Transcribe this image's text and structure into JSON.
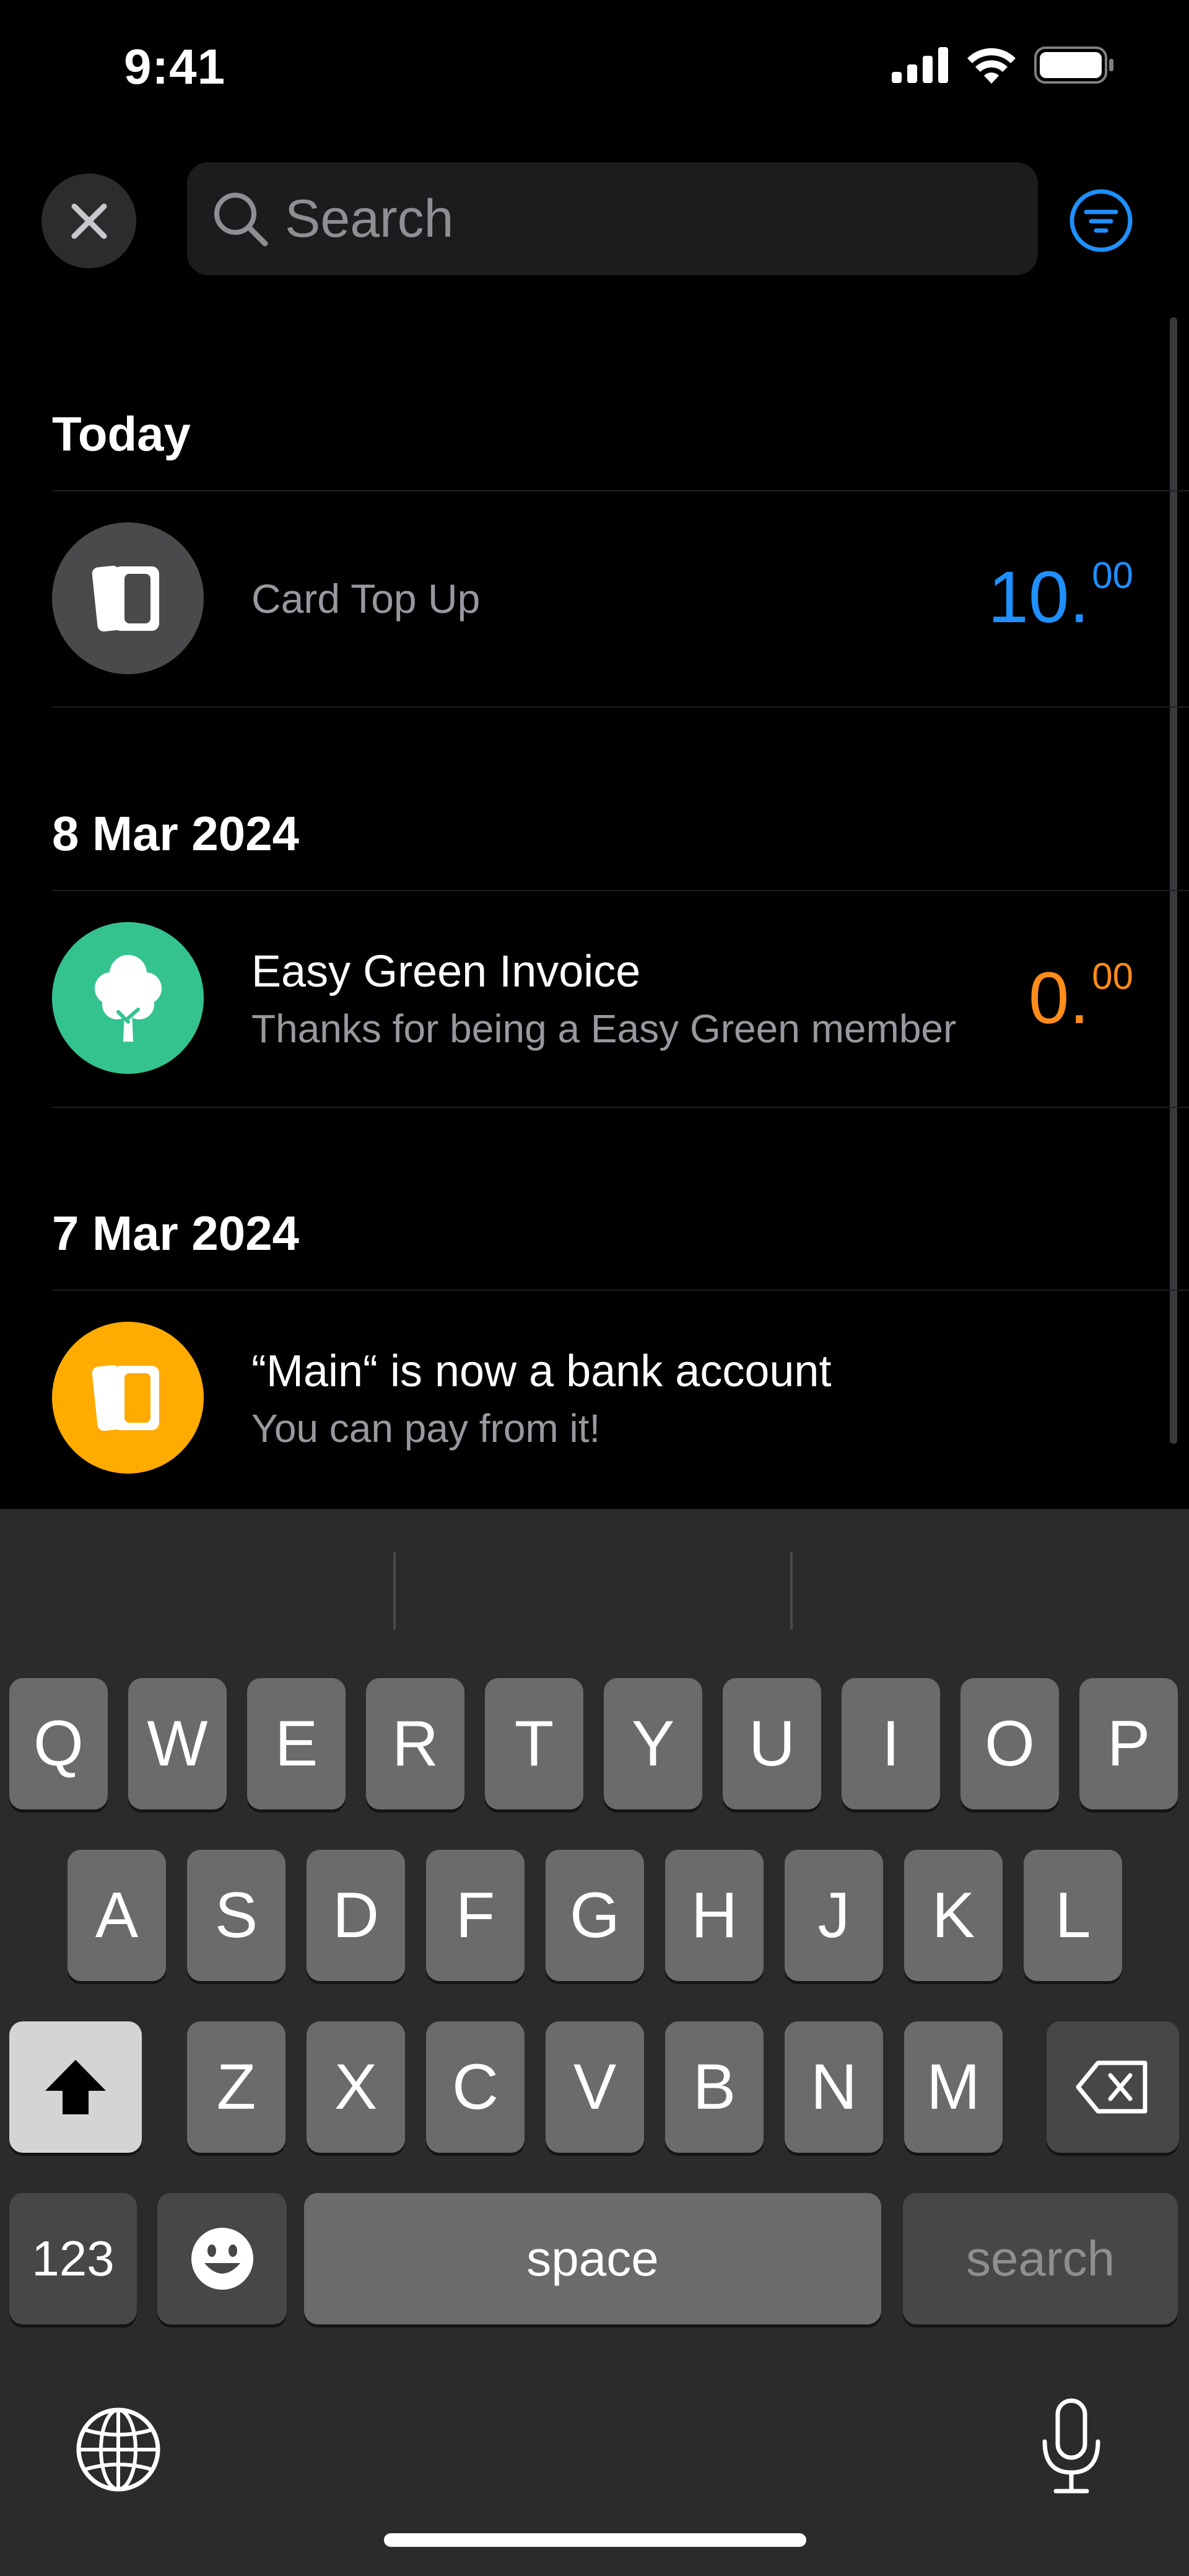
{
  "status": {
    "time": "9:41"
  },
  "search": {
    "placeholder": "Search"
  },
  "sections": [
    {
      "header": "Today",
      "item": {
        "title": "Card Top Up",
        "amount_int": "10",
        "amount_frac": "00",
        "color": "#1e90ff",
        "icon": "card-icon",
        "avatar_bg": "#4a4a4c"
      }
    },
    {
      "header": "8 Mar 2024",
      "item": {
        "title": "Easy Green Invoice",
        "subtitle": "Thanks for being a Easy Green member",
        "amount_int": "0",
        "amount_frac": "00",
        "color": "#ff8c1a",
        "icon": "tree-icon",
        "avatar_bg": "#34c38f"
      }
    },
    {
      "header": "7 Mar 2024",
      "item": {
        "title": "“Main“ is now a bank account",
        "subtitle": "You can pay from it!",
        "icon": "card-icon",
        "avatar_bg": "#ffab00"
      }
    }
  ],
  "keyboard": {
    "row1": [
      "Q",
      "W",
      "E",
      "R",
      "T",
      "Y",
      "U",
      "I",
      "O",
      "P"
    ],
    "row2": [
      "A",
      "S",
      "D",
      "F",
      "G",
      "H",
      "J",
      "K",
      "L"
    ],
    "row3": [
      "Z",
      "X",
      "C",
      "V",
      "B",
      "N",
      "M"
    ],
    "numbers_label": "123",
    "space_label": "space",
    "search_label": "search"
  }
}
